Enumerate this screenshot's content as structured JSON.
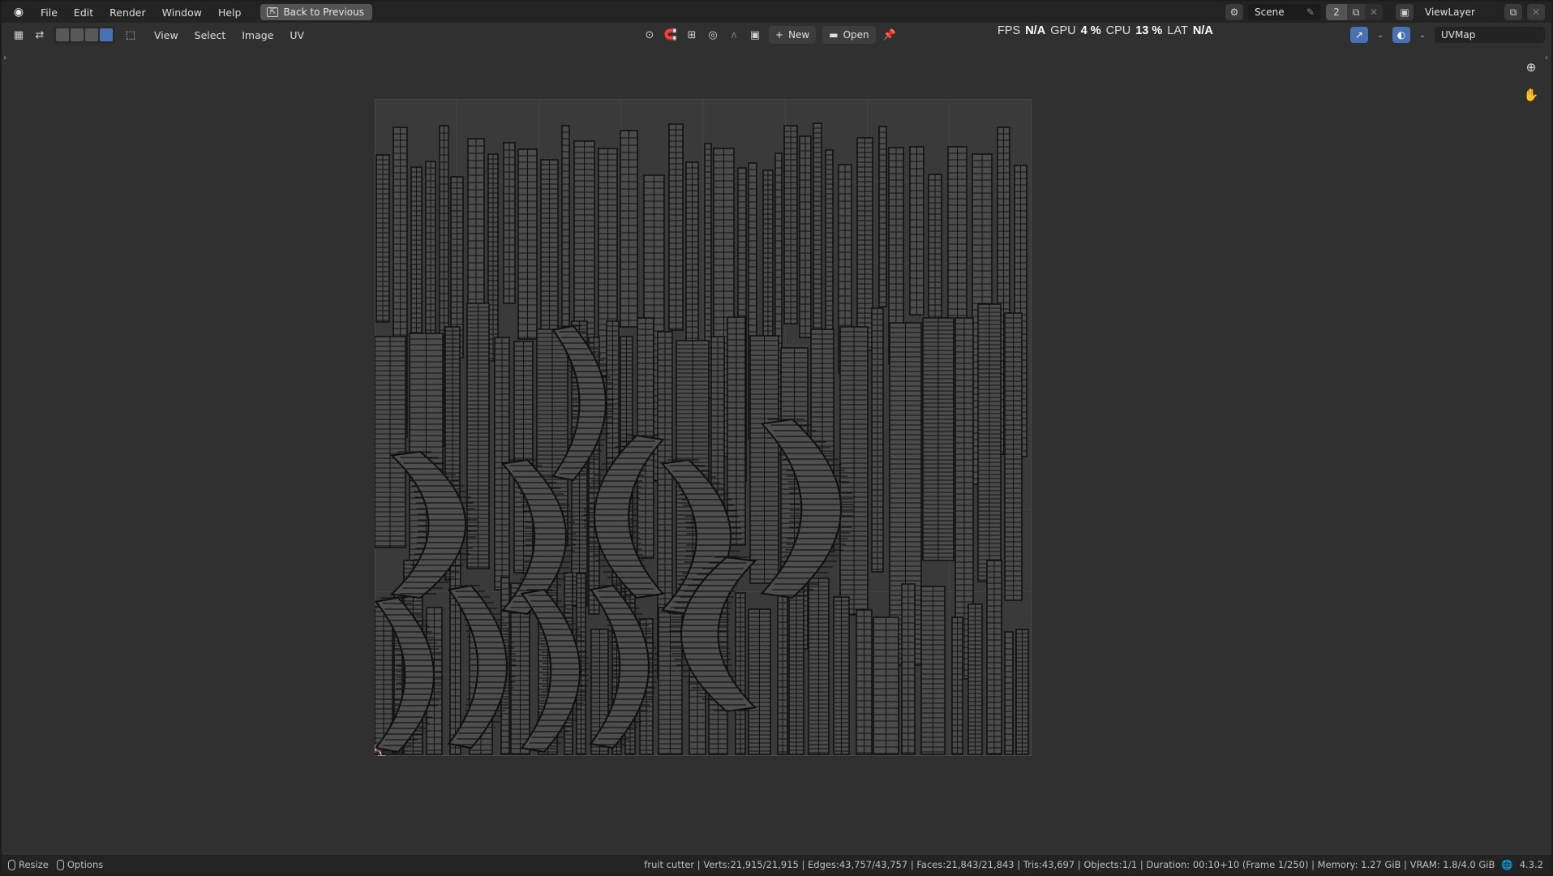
{
  "topbar": {
    "menus": [
      "File",
      "Edit",
      "Render",
      "Window",
      "Help"
    ],
    "back_button": "Back to Previous",
    "scene_label": "Scene",
    "scene_users": "2",
    "view_layer": "ViewLayer"
  },
  "header": {
    "menus": [
      "View",
      "Select",
      "Image",
      "UV"
    ],
    "new_label": "New",
    "open_label": "Open",
    "uvmap": "UVMap"
  },
  "perf": {
    "fps_label": "FPS",
    "fps_value": "N/A",
    "gpu_label": "GPU",
    "gpu_value": "4 %",
    "cpu_label": "CPU",
    "cpu_value": "13 %",
    "lat_label": "LAT",
    "lat_value": "N/A"
  },
  "status": {
    "resize": "Resize",
    "options": "Options",
    "stats": "fruit cutter | Verts:21,915/21,915 | Edges:43,757/43,757 | Faces:21,843/21,843 | Tris:43,697 | Objects:1/1 | Duration: 00:10+10 (Frame 1/250) | Memory: 1.27 GiB | VRAM: 1.8/4.0 GiB",
    "version": "4.3.2"
  },
  "colors": {
    "accent": "#4772b3",
    "background": "#303030",
    "uv_fill": "#4b4b4b",
    "uv_edge": "#101010"
  }
}
